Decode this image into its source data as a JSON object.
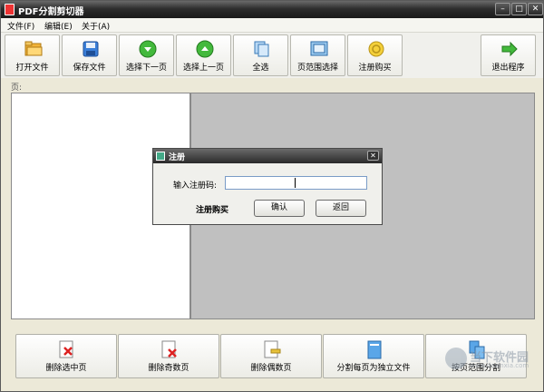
{
  "window": {
    "title": "PDF分割剪切器"
  },
  "menu": [
    "文件(F)",
    "编辑(E)",
    "关于(A)"
  ],
  "toolbar": [
    {
      "label": "打开文件",
      "icon": "folder-open-icon"
    },
    {
      "label": "保存文件",
      "icon": "save-disk-icon"
    },
    {
      "label": "选择下一页",
      "icon": "arrow-down-circle-icon"
    },
    {
      "label": "选择上一页",
      "icon": "arrow-up-circle-icon"
    },
    {
      "label": "全选",
      "icon": "select-all-pages-icon"
    },
    {
      "label": "页范围选择",
      "icon": "page-range-icon"
    },
    {
      "label": "注册购买",
      "icon": "register-coin-icon"
    },
    {
      "label": "退出程序",
      "icon": "exit-arrow-icon"
    }
  ],
  "page_label": "页:",
  "dialog": {
    "title": "注册",
    "code_label": "输入注册码:",
    "code_value": "",
    "buy_label": "注册购买",
    "ok_label": "确认",
    "back_label": "返回"
  },
  "bottom": [
    {
      "label": "删除选中页",
      "icon": "delete-selected-page-icon"
    },
    {
      "label": "删除奇数页",
      "icon": "delete-odd-pages-icon"
    },
    {
      "label": "删除偶数页",
      "icon": "delete-even-pages-icon"
    },
    {
      "label": "分割每页为独立文件",
      "icon": "split-each-page-icon"
    },
    {
      "label": "按页范围分割",
      "icon": "split-by-range-icon"
    }
  ],
  "watermark": {
    "text": "当下软件园",
    "url": "www.downxia.com"
  }
}
